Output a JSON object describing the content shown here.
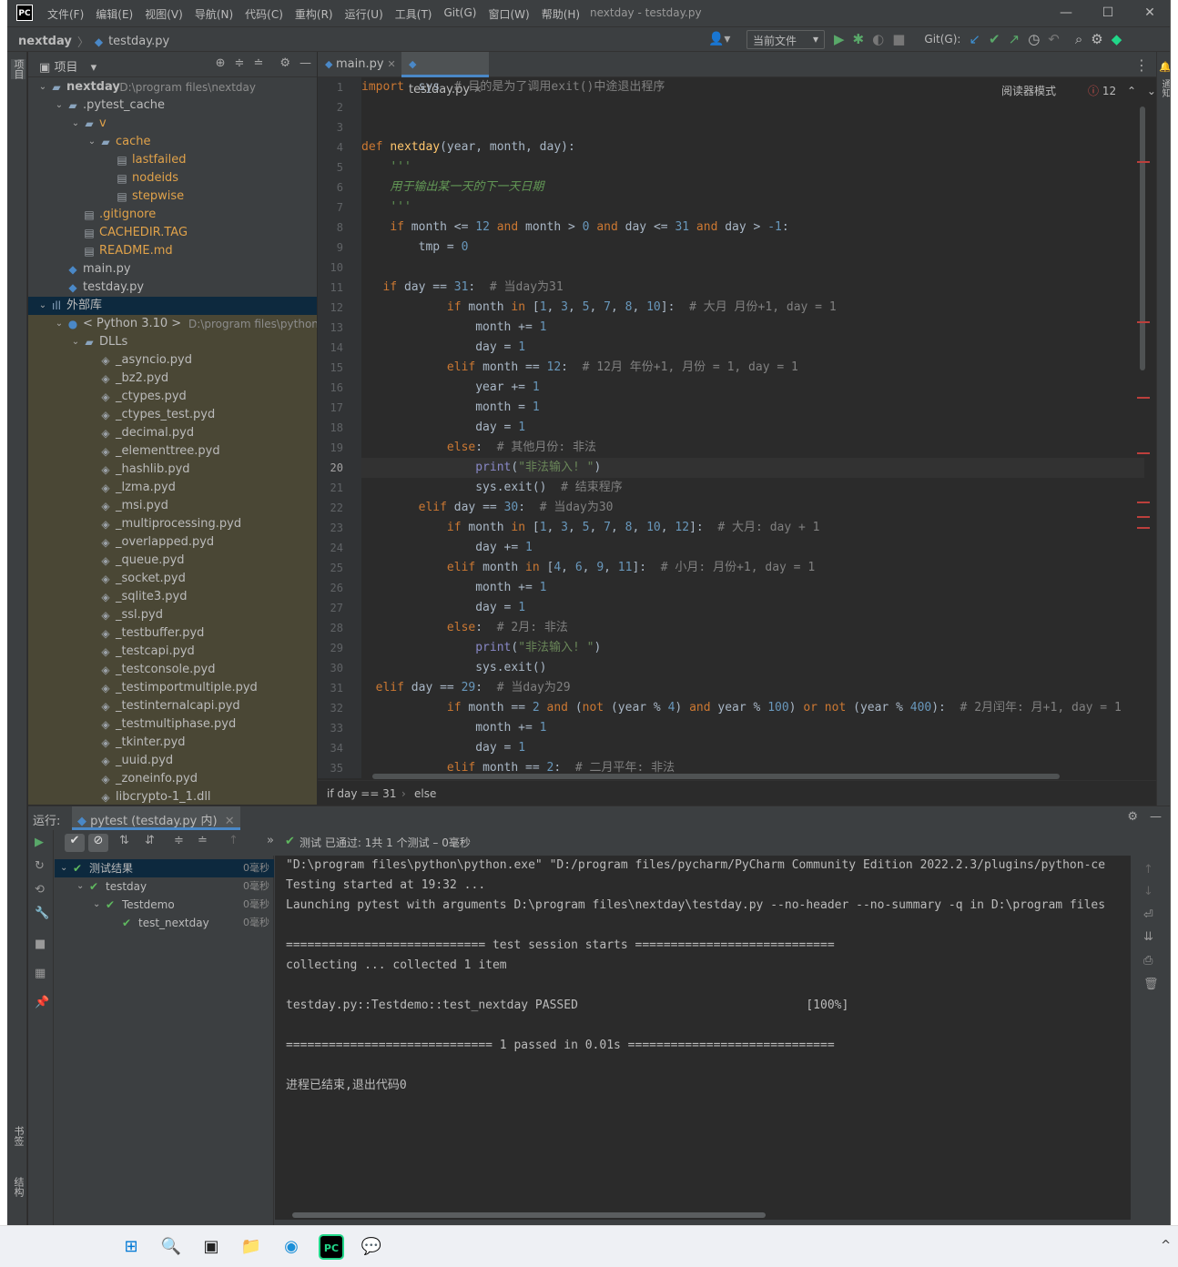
{
  "window": {
    "app_logo": "PC",
    "title": "nextday - testday.py",
    "menu": [
      "文件(F)",
      "编辑(E)",
      "视图(V)",
      "导航(N)",
      "代码(C)",
      "重构(R)",
      "运行(U)",
      "工具(T)",
      "Git(G)",
      "窗口(W)",
      "帮助(H)"
    ],
    "controls": [
      "minimize-icon",
      "maximize-icon",
      "close-icon"
    ]
  },
  "navbar": {
    "project": "nextday",
    "file": "testday.py",
    "run_config": "当前文件",
    "git_label": "Git(G):"
  },
  "left_strip": {
    "project_tab": "项目",
    "bookmarks_tab": "书签",
    "structure_tab": "结构"
  },
  "right_strip": {
    "notifications_tab": "通知"
  },
  "project_panel": {
    "title": "项目",
    "tree": [
      {
        "label": "nextday",
        "extra": "D:\\program files\\nextday",
        "depth": 0,
        "expanded": true,
        "kind": "folder",
        "bold": true
      },
      {
        "label": ".pytest_cache",
        "depth": 1,
        "expanded": true,
        "kind": "folder"
      },
      {
        "label": "v",
        "depth": 2,
        "expanded": true,
        "kind": "folder",
        "color": "#e0a24a"
      },
      {
        "label": "cache",
        "depth": 3,
        "expanded": true,
        "kind": "folder",
        "color": "#e0a24a"
      },
      {
        "label": "lastfailed",
        "depth": 4,
        "kind": "file",
        "color": "#e0a24a"
      },
      {
        "label": "nodeids",
        "depth": 4,
        "kind": "file",
        "color": "#e0a24a"
      },
      {
        "label": "stepwise",
        "depth": 4,
        "kind": "file",
        "color": "#e0a24a"
      },
      {
        "label": ".gitignore",
        "depth": 2,
        "kind": "file",
        "color": "#e0a24a"
      },
      {
        "label": "CACHEDIR.TAG",
        "depth": 2,
        "kind": "file",
        "color": "#e0a24a"
      },
      {
        "label": "README.md",
        "depth": 2,
        "kind": "file",
        "color": "#e0a24a"
      },
      {
        "label": "main.py",
        "depth": 1,
        "kind": "py"
      },
      {
        "label": "testday.py",
        "depth": 1,
        "kind": "py"
      },
      {
        "label": "外部库",
        "depth": 0,
        "expanded": true,
        "kind": "lib",
        "selected": true
      },
      {
        "label": "< Python 3.10 >",
        "extra": "D:\\program files\\python\\py",
        "depth": 1,
        "expanded": true,
        "kind": "python"
      },
      {
        "label": "DLLs",
        "depth": 2,
        "expanded": true,
        "kind": "folder"
      },
      {
        "label": "_asyncio.pyd",
        "depth": 3,
        "kind": "pyd"
      },
      {
        "label": "_bz2.pyd",
        "depth": 3,
        "kind": "pyd"
      },
      {
        "label": "_ctypes.pyd",
        "depth": 3,
        "kind": "pyd"
      },
      {
        "label": "_ctypes_test.pyd",
        "depth": 3,
        "kind": "pyd"
      },
      {
        "label": "_decimal.pyd",
        "depth": 3,
        "kind": "pyd"
      },
      {
        "label": "_elementtree.pyd",
        "depth": 3,
        "kind": "pyd"
      },
      {
        "label": "_hashlib.pyd",
        "depth": 3,
        "kind": "pyd"
      },
      {
        "label": "_lzma.pyd",
        "depth": 3,
        "kind": "pyd"
      },
      {
        "label": "_msi.pyd",
        "depth": 3,
        "kind": "pyd"
      },
      {
        "label": "_multiprocessing.pyd",
        "depth": 3,
        "kind": "pyd"
      },
      {
        "label": "_overlapped.pyd",
        "depth": 3,
        "kind": "pyd"
      },
      {
        "label": "_queue.pyd",
        "depth": 3,
        "kind": "pyd"
      },
      {
        "label": "_socket.pyd",
        "depth": 3,
        "kind": "pyd"
      },
      {
        "label": "_sqlite3.pyd",
        "depth": 3,
        "kind": "pyd"
      },
      {
        "label": "_ssl.pyd",
        "depth": 3,
        "kind": "pyd"
      },
      {
        "label": "_testbuffer.pyd",
        "depth": 3,
        "kind": "pyd"
      },
      {
        "label": "_testcapi.pyd",
        "depth": 3,
        "kind": "pyd"
      },
      {
        "label": "_testconsole.pyd",
        "depth": 3,
        "kind": "pyd"
      },
      {
        "label": "_testimportmultiple.pyd",
        "depth": 3,
        "kind": "pyd"
      },
      {
        "label": "_testinternalcapi.pyd",
        "depth": 3,
        "kind": "pyd"
      },
      {
        "label": "_testmultiphase.pyd",
        "depth": 3,
        "kind": "pyd"
      },
      {
        "label": "_tkinter.pyd",
        "depth": 3,
        "kind": "pyd"
      },
      {
        "label": "_uuid.pyd",
        "depth": 3,
        "kind": "pyd"
      },
      {
        "label": "_zoneinfo.pyd",
        "depth": 3,
        "kind": "pyd"
      },
      {
        "label": "libcrypto-1_1.dll",
        "depth": 3,
        "kind": "pyd"
      }
    ]
  },
  "editor": {
    "tabs": [
      {
        "label": "main.py",
        "active": false
      },
      {
        "label": "testday.py",
        "active": true
      }
    ],
    "reader_mode": "阅读器模式",
    "error_count": "12",
    "current_line": 20,
    "lines": [
      [
        [
          "kw",
          "import"
        ],
        [
          "",
          "  sys  "
        ],
        [
          "cm",
          "# 目的是为了调用exit()中途退出程序"
        ]
      ],
      [],
      [],
      [
        [
          "kw",
          "def "
        ],
        [
          "fn",
          "nextday"
        ],
        [
          "",
          "(year, month, day):"
        ]
      ],
      [
        [
          "",
          "    "
        ],
        [
          "it",
          "'''"
        ]
      ],
      [
        [
          "",
          "    "
        ],
        [
          "it",
          "用于输出某一天的下一天日期"
        ]
      ],
      [
        [
          "",
          "    "
        ],
        [
          "it",
          "'''"
        ]
      ],
      [
        [
          "",
          "    "
        ],
        [
          "kw",
          "if "
        ],
        [
          "",
          "month <= "
        ],
        [
          "nm",
          "12"
        ],
        [
          "kw",
          " and "
        ],
        [
          "",
          "month > "
        ],
        [
          "nm",
          "0"
        ],
        [
          "kw",
          " and "
        ],
        [
          "",
          "day <= "
        ],
        [
          "nm",
          "31"
        ],
        [
          "kw",
          " and "
        ],
        [
          "",
          "day > "
        ],
        [
          "nm",
          "-1"
        ],
        [
          "",
          ":"
        ]
      ],
      [
        [
          "",
          "        tmp = "
        ],
        [
          "nm",
          "0"
        ]
      ],
      [],
      [
        [
          "",
          "   "
        ],
        [
          "kw",
          "if "
        ],
        [
          "",
          "day == "
        ],
        [
          "nm",
          "31"
        ],
        [
          "",
          ":  "
        ],
        [
          "cm",
          "# 当day为31"
        ]
      ],
      [
        [
          "",
          "            "
        ],
        [
          "kw",
          "if "
        ],
        [
          "",
          "month "
        ],
        [
          "kw",
          "in "
        ],
        [
          "",
          "["
        ],
        [
          "nm",
          "1"
        ],
        [
          "",
          ", "
        ],
        [
          "nm",
          "3"
        ],
        [
          "",
          ", "
        ],
        [
          "nm",
          "5"
        ],
        [
          "",
          ", "
        ],
        [
          "nm",
          "7"
        ],
        [
          "",
          ", "
        ],
        [
          "nm",
          "8"
        ],
        [
          "",
          ", "
        ],
        [
          "nm",
          "10"
        ],
        [
          "",
          "]:  "
        ],
        [
          "cm",
          "# 大月 月份+1, day = 1"
        ]
      ],
      [
        [
          "",
          "                month += "
        ],
        [
          "nm",
          "1"
        ]
      ],
      [
        [
          "",
          "                day = "
        ],
        [
          "nm",
          "1"
        ]
      ],
      [
        [
          "",
          "            "
        ],
        [
          "kw",
          "elif "
        ],
        [
          "",
          "month == "
        ],
        [
          "nm",
          "12"
        ],
        [
          "",
          ":  "
        ],
        [
          "cm",
          "# 12月 年份+1, 月份 = 1, day = 1"
        ]
      ],
      [
        [
          "",
          "                year += "
        ],
        [
          "nm",
          "1"
        ]
      ],
      [
        [
          "",
          "                month = "
        ],
        [
          "nm",
          "1"
        ]
      ],
      [
        [
          "",
          "                day = "
        ],
        [
          "nm",
          "1"
        ]
      ],
      [
        [
          "",
          "            "
        ],
        [
          "kw",
          "else"
        ],
        [
          "",
          ":  "
        ],
        [
          "cm",
          "# 其他月份: 非法"
        ]
      ],
      [
        [
          "",
          "                "
        ],
        [
          "bi",
          "print"
        ],
        [
          "",
          "("
        ],
        [
          "st",
          "\"非法输入! \""
        ],
        [
          "",
          ")"
        ]
      ],
      [
        [
          "",
          "                sys.exit()  "
        ],
        [
          "cm",
          "# 结束程序"
        ]
      ],
      [
        [
          "",
          "        "
        ],
        [
          "kw",
          "elif "
        ],
        [
          "",
          "day == "
        ],
        [
          "nm",
          "30"
        ],
        [
          "",
          ":  "
        ],
        [
          "cm",
          "# 当day为30"
        ]
      ],
      [
        [
          "",
          "            "
        ],
        [
          "kw",
          "if "
        ],
        [
          "",
          "month "
        ],
        [
          "kw",
          "in "
        ],
        [
          "",
          "["
        ],
        [
          "nm",
          "1"
        ],
        [
          "",
          ", "
        ],
        [
          "nm",
          "3"
        ],
        [
          "",
          ", "
        ],
        [
          "nm",
          "5"
        ],
        [
          "",
          ", "
        ],
        [
          "nm",
          "7"
        ],
        [
          "",
          ", "
        ],
        [
          "nm",
          "8"
        ],
        [
          "",
          ", "
        ],
        [
          "nm",
          "10"
        ],
        [
          "",
          ", "
        ],
        [
          "nm",
          "12"
        ],
        [
          "",
          "]:  "
        ],
        [
          "cm",
          "# 大月: day + 1"
        ]
      ],
      [
        [
          "",
          "                day += "
        ],
        [
          "nm",
          "1"
        ]
      ],
      [
        [
          "",
          "            "
        ],
        [
          "kw",
          "elif "
        ],
        [
          "",
          "month "
        ],
        [
          "kw",
          "in "
        ],
        [
          "",
          "["
        ],
        [
          "nm",
          "4"
        ],
        [
          "",
          ", "
        ],
        [
          "nm",
          "6"
        ],
        [
          "",
          ", "
        ],
        [
          "nm",
          "9"
        ],
        [
          "",
          ", "
        ],
        [
          "nm",
          "11"
        ],
        [
          "",
          "]:  "
        ],
        [
          "cm",
          "# 小月: 月份+1, day = 1"
        ]
      ],
      [
        [
          "",
          "                month += "
        ],
        [
          "nm",
          "1"
        ]
      ],
      [
        [
          "",
          "                day = "
        ],
        [
          "nm",
          "1"
        ]
      ],
      [
        [
          "",
          "            "
        ],
        [
          "kw",
          "else"
        ],
        [
          "",
          ":  "
        ],
        [
          "cm",
          "# 2月: 非法"
        ]
      ],
      [
        [
          "",
          "                "
        ],
        [
          "bi",
          "print"
        ],
        [
          "",
          "("
        ],
        [
          "st",
          "\"非法输入! \""
        ],
        [
          "",
          ")"
        ]
      ],
      [
        [
          "",
          "                sys.exit()"
        ]
      ],
      [
        [
          "",
          "  "
        ],
        [
          "kw",
          "elif "
        ],
        [
          "",
          "day == "
        ],
        [
          "nm",
          "29"
        ],
        [
          "",
          ":  "
        ],
        [
          "cm",
          "# 当day为29"
        ]
      ],
      [
        [
          "",
          "            "
        ],
        [
          "kw",
          "if "
        ],
        [
          "",
          "month == "
        ],
        [
          "nm",
          "2"
        ],
        [
          "kw",
          " and "
        ],
        [
          "",
          "("
        ],
        [
          "kw",
          "not "
        ],
        [
          "",
          "(year % "
        ],
        [
          "nm",
          "4"
        ],
        [
          "",
          ") "
        ],
        [
          "kw",
          "and "
        ],
        [
          "",
          "year % "
        ],
        [
          "nm",
          "100"
        ],
        [
          "",
          ") "
        ],
        [
          "kw",
          "or not "
        ],
        [
          "",
          "(year % "
        ],
        [
          "nm",
          "400"
        ],
        [
          "",
          "):  "
        ],
        [
          "cm",
          "# 2月闰年: 月+1, day = 1"
        ]
      ],
      [
        [
          "",
          "                month += "
        ],
        [
          "nm",
          "1"
        ]
      ],
      [
        [
          "",
          "                day = "
        ],
        [
          "nm",
          "1"
        ]
      ],
      [
        [
          "",
          "            "
        ],
        [
          "kw",
          "elif "
        ],
        [
          "",
          "month == "
        ],
        [
          "nm",
          "2"
        ],
        [
          "",
          ":  "
        ],
        [
          "cm",
          "# 二月平年: 非法"
        ]
      ]
    ],
    "breadcrumb": [
      "if day == 31",
      "else"
    ]
  },
  "run_panel": {
    "label": "运行:",
    "tab": "pytest (testday.py 内)",
    "status": "测试 已通过: 1共 1 个测试 – 0毫秒",
    "tree": [
      {
        "label": "测试结果",
        "time": "0毫秒",
        "depth": 0,
        "selected": true
      },
      {
        "label": "testday",
        "time": "0毫秒",
        "depth": 1
      },
      {
        "label": "Testdemo",
        "time": "0毫秒",
        "depth": 2
      },
      {
        "label": "test_nextday",
        "time": "0毫秒",
        "depth": 3
      }
    ],
    "console": [
      "\"D:\\program files\\python\\python.exe\" \"D:/program files/pycharm/PyCharm Community Edition 2022.2.3/plugins/python-ce",
      "Testing started at 19:32 ...",
      "Launching pytest with arguments D:\\program files\\nextday\\testday.py --no-header --no-summary -q in D:\\program files",
      "",
      "============================ test session starts ============================",
      "collecting ... collected 1 item",
      "",
      "testday.py::Testdemo::test_nextday PASSED                                [100%]",
      "",
      "============================= 1 passed in 0.01s =============================",
      "",
      "进程已结束,退出代码0"
    ]
  },
  "taskbar": {
    "items": [
      {
        "name": "windows-start-icon",
        "glyph": "⊞",
        "color": "#0078d4"
      },
      {
        "name": "search-icon",
        "glyph": "🔍",
        "color": "#222222"
      },
      {
        "name": "task-view-icon",
        "glyph": "▣",
        "color": "#222222"
      },
      {
        "name": "file-explorer-icon",
        "glyph": "📁",
        "color": "#e8b030"
      },
      {
        "name": "edge-browser-icon",
        "glyph": "◉",
        "color": "#1a8fd8"
      },
      {
        "name": "pycharm-icon",
        "glyph": "PC",
        "color": "#21d789"
      },
      {
        "name": "wechat-icon",
        "glyph": "💬",
        "color": "#2aae67"
      }
    ],
    "tray_chevron": "^"
  },
  "colors": {
    "accent": "#4a88c7",
    "pass": "#5fb85f",
    "error": "#bc3f3c"
  }
}
